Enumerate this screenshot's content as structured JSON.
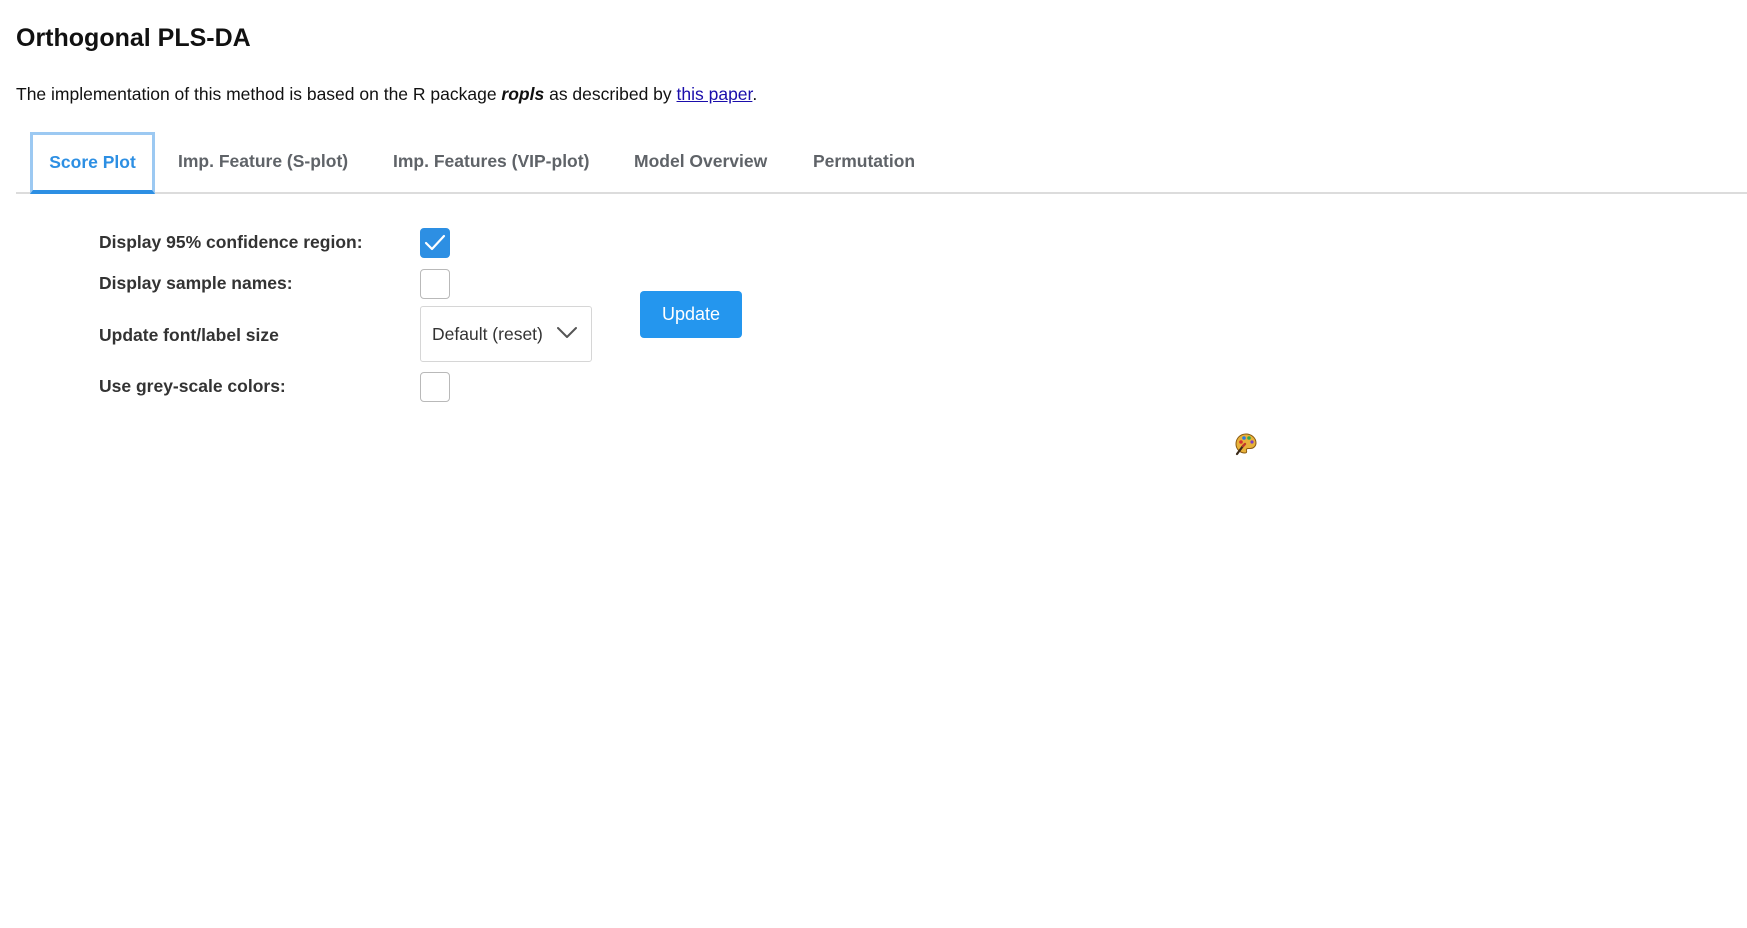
{
  "header": {
    "title": "Orthogonal PLS-DA",
    "intro_prefix": "The implementation of this method is based on the R package ",
    "intro_package": "ropls",
    "intro_middle": " as described by ",
    "intro_link": "this paper",
    "intro_suffix": "."
  },
  "tabs": [
    {
      "label": "Score Plot",
      "active": true
    },
    {
      "label": "Imp. Feature (S-plot)",
      "active": false
    },
    {
      "label": "Imp. Features (VIP-plot)",
      "active": false
    },
    {
      "label": "Model Overview",
      "active": false
    },
    {
      "label": "Permutation",
      "active": false
    }
  ],
  "options": {
    "confidence_region": {
      "label": "Display 95% confidence region:",
      "checked": true
    },
    "sample_names": {
      "label": "Display sample names:",
      "checked": false
    },
    "font_size": {
      "label": "Update font/label size",
      "selected": "Default (reset)"
    },
    "grey_scale": {
      "label": "Use grey-scale colors:",
      "checked": false
    }
  },
  "actions": {
    "update_label": "Update"
  },
  "icons": {
    "palette": "palette-icon",
    "check": "check-icon",
    "dropdown": "chevron-down-icon"
  },
  "colors": {
    "accent": "#2d8fe3",
    "button": "#2496ee",
    "link": "#1a0dab"
  }
}
